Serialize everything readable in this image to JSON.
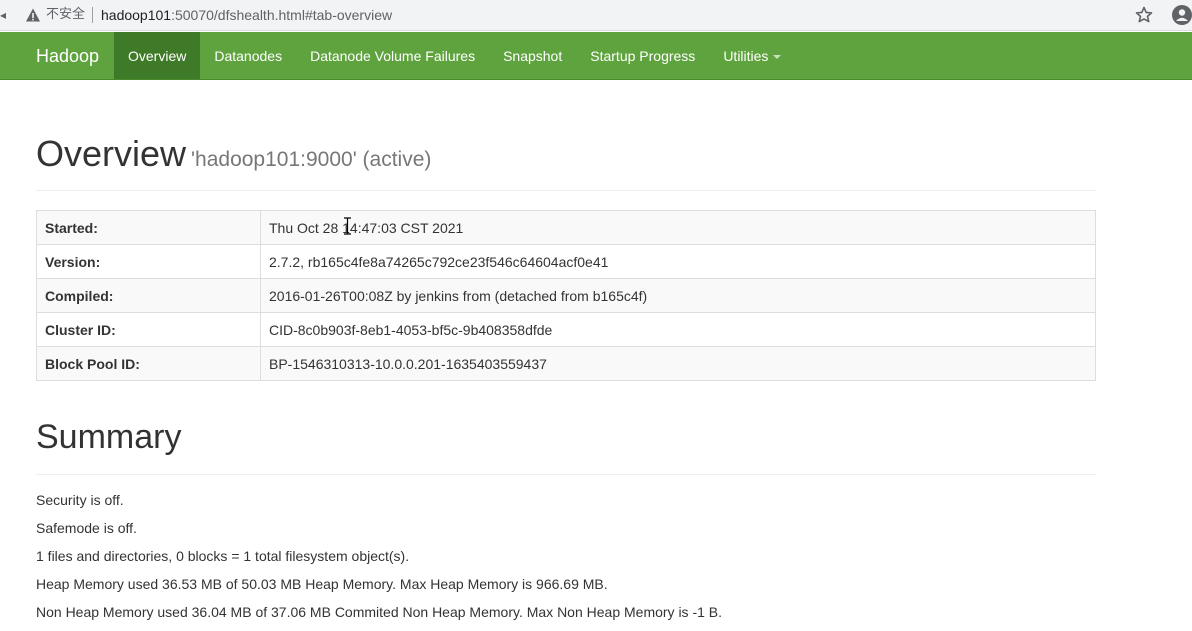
{
  "browser": {
    "insecure_label": "不安全",
    "url_host": "hadoop101",
    "url_rest": ":50070/dfshealth.html#tab-overview",
    "icons": [
      "warning-icon",
      "star-icon",
      "profile-icon"
    ]
  },
  "navbar": {
    "brand": "Hadoop",
    "items": [
      {
        "label": "Overview",
        "active": true
      },
      {
        "label": "Datanodes",
        "active": false
      },
      {
        "label": "Datanode Volume Failures",
        "active": false
      },
      {
        "label": "Snapshot",
        "active": false
      },
      {
        "label": "Startup Progress",
        "active": false
      },
      {
        "label": "Utilities",
        "active": false
      }
    ],
    "color": "#5fa33e",
    "active_color": "#3f7a28"
  },
  "overview": {
    "title": "Overview",
    "subtitle": "'hadoop101:9000' (active)",
    "rows": [
      {
        "key": "Started:",
        "value": "Thu Oct 28 14:47:03 CST 2021"
      },
      {
        "key": "Version:",
        "value": "2.7.2, rb165c4fe8a74265c792ce23f546c64604acf0e41"
      },
      {
        "key": "Compiled:",
        "value": "2016-01-26T00:08Z by jenkins from (detached from b165c4f)"
      },
      {
        "key": "Cluster ID:",
        "value": "CID-8c0b903f-8eb1-4053-bf5c-9b408358dfde"
      },
      {
        "key": "Block Pool ID:",
        "value": "BP-1546310313-10.0.0.201-1635403559437"
      }
    ]
  },
  "summary": {
    "title": "Summary",
    "lines": [
      "Security is off.",
      "Safemode is off.",
      "1 files and directories, 0 blocks = 1 total filesystem object(s).",
      "Heap Memory used 36.53 MB of 50.03 MB Heap Memory. Max Heap Memory is 966.69 MB.",
      "Non Heap Memory used 36.04 MB of 37.06 MB Commited Non Heap Memory. Max Non Heap Memory is -1 B."
    ]
  }
}
